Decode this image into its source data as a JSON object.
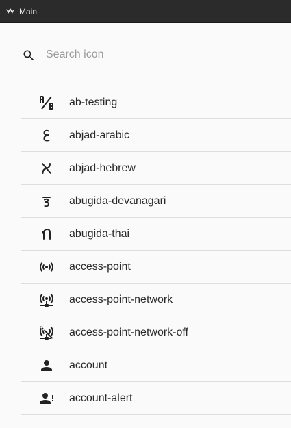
{
  "window": {
    "title": "Main"
  },
  "search": {
    "placeholder": "Search icon",
    "value": ""
  },
  "icons": [
    {
      "name": "ab-testing",
      "icon": "ab-testing-icon"
    },
    {
      "name": "abjad-arabic",
      "icon": "abjad-arabic-icon"
    },
    {
      "name": "abjad-hebrew",
      "icon": "abjad-hebrew-icon"
    },
    {
      "name": "abugida-devanagari",
      "icon": "abugida-devanagari-icon"
    },
    {
      "name": "abugida-thai",
      "icon": "abugida-thai-icon"
    },
    {
      "name": "access-point",
      "icon": "access-point-icon"
    },
    {
      "name": "access-point-network",
      "icon": "access-point-network-icon"
    },
    {
      "name": "access-point-network-off",
      "icon": "access-point-network-off-icon"
    },
    {
      "name": "account",
      "icon": "account-icon"
    },
    {
      "name": "account-alert",
      "icon": "account-alert-icon"
    }
  ],
  "colors": {
    "titlebar": "#2b2b2b",
    "background": "#fafafa",
    "divider": "#dedede",
    "text": "#2a2a2a"
  }
}
